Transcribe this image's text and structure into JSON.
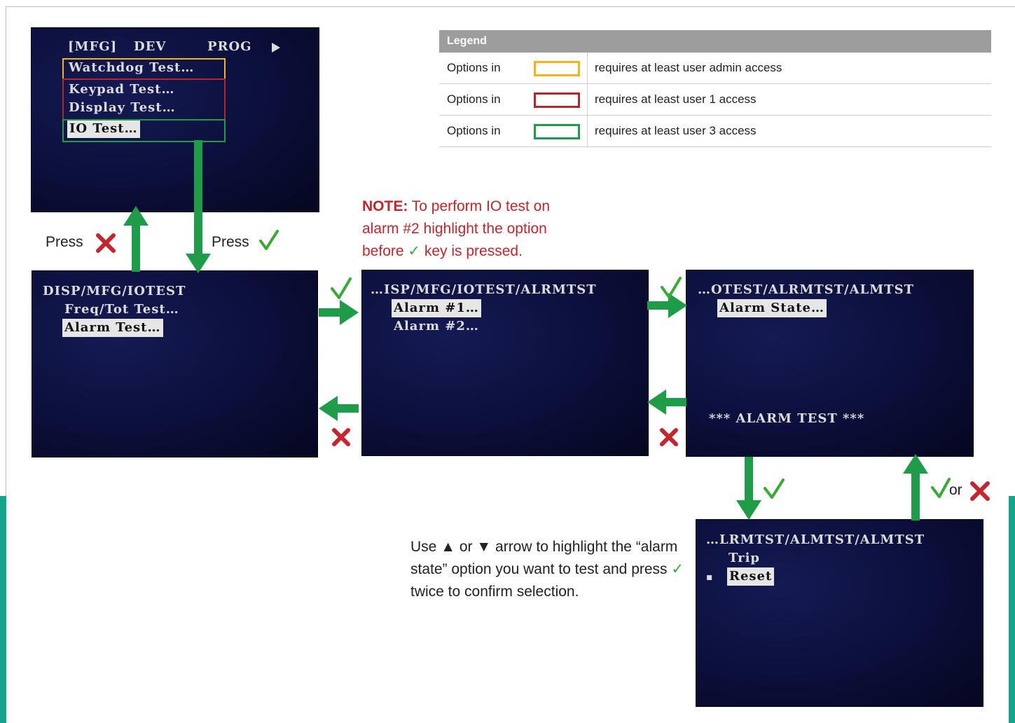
{
  "legend": {
    "title": "Legend",
    "rows": [
      {
        "label": "Options in",
        "desc": "requires at least user admin access",
        "color": "#f5b21a"
      },
      {
        "label": "Options in",
        "desc": "requires at least user 1 access",
        "color": "#b3262c"
      },
      {
        "label": "Options in",
        "desc": "requires at least user 3 access",
        "color": "#1f9c47"
      }
    ]
  },
  "colors": {
    "arrow": "#1f9c47",
    "check": "#3aa935",
    "cross": "#c4262e",
    "note": "#c0272d"
  },
  "screen_main": {
    "tabs": [
      "[MFG]",
      "DEV",
      "PROG"
    ],
    "more_icon": "play-triangle-icon",
    "items": [
      "Watchdog Test…",
      "Keypad Test…",
      "Display Test…",
      "IO Test…"
    ]
  },
  "screen_iotest": {
    "path": "DISP/MFG/IOTEST",
    "items": [
      "Freq/Tot Test…",
      "Alarm Test…"
    ]
  },
  "screen_alrmtst": {
    "path": "…ISP/MFG/IOTEST/ALRMTST",
    "items": [
      "Alarm #1…",
      "Alarm #2…"
    ]
  },
  "screen_almtst": {
    "path": "…OTEST/ALRMTST/ALMTST",
    "items": [
      "Alarm State…"
    ],
    "footer": "*** ALARM TEST ***"
  },
  "screen_state": {
    "path": "…LRMTST/ALMTST/ALMTST",
    "items": [
      "Trip",
      "Reset"
    ],
    "bullet": "▪"
  },
  "labels": {
    "press": "Press",
    "or": "or"
  },
  "symbols": {
    "check": "✓",
    "cross": "✕",
    "up": "▲",
    "down": "▼"
  },
  "note": {
    "prefix": "NOTE:",
    "line1": "To perform IO test on",
    "line2": "alarm #2 highlight the option",
    "line3a": "before",
    "line3b": "key is pressed."
  },
  "instruction": {
    "p1": "Use",
    "p2": "or",
    "p3": "arrow to highlight the “alarm state” option you want to test and press",
    "p4": "twice to confirm selection."
  }
}
